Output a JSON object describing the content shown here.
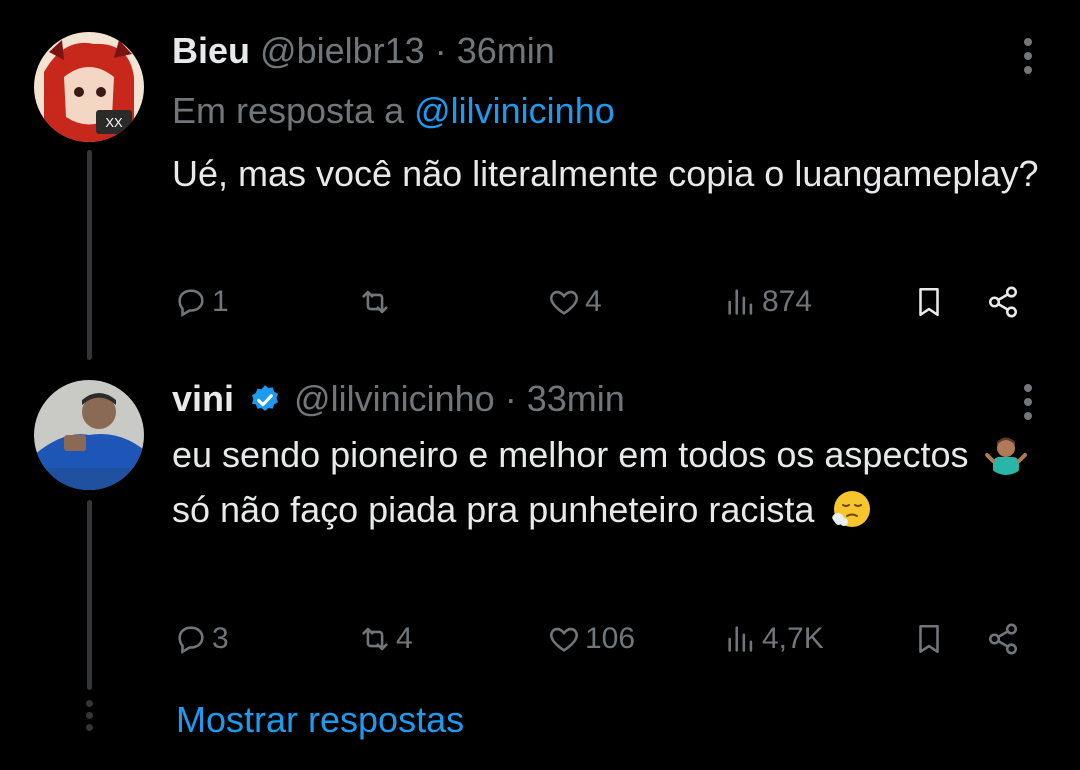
{
  "tweets": [
    {
      "name": "Bieu",
      "handle": "@bielbr13",
      "separator": "·",
      "time": "36min",
      "reply_prefix": "Em resposta a",
      "reply_handle": "@lilvinicinho",
      "text": "Ué, mas você não literalmente copia o luangameplay?",
      "verified": false,
      "stats": {
        "replies": "1",
        "retweets": "",
        "likes": "4",
        "views": "874"
      },
      "avatar_colors": {
        "bg": "#f2e3d3",
        "hair": "#c8281c",
        "accent": "#3a1a14"
      }
    },
    {
      "name": "vini",
      "handle": "@lilvinicinho",
      "separator": "·",
      "time": "33min",
      "text_parts": [
        "eu sendo pioneiro e melhor em todos os aspectos",
        "só não faço piada pra punheteiro racista"
      ],
      "emojis": [
        "person-shrugging-emoji",
        "face-exhaling-emoji"
      ],
      "verified": true,
      "stats": {
        "replies": "3",
        "retweets": "4",
        "likes": "106",
        "views": "4,7K"
      },
      "avatar_colors": {
        "bg": "#c9c9c6",
        "shirt": "#1e56b8",
        "skin": "#8b6a55"
      }
    }
  ],
  "show_replies": "Mostrar respostas",
  "colors": {
    "background": "#000000",
    "text": "#e7e9ea",
    "muted": "#71767b",
    "link": "#1d9bf0",
    "verified": "#1d9bf0",
    "thread_line": "#333639"
  }
}
